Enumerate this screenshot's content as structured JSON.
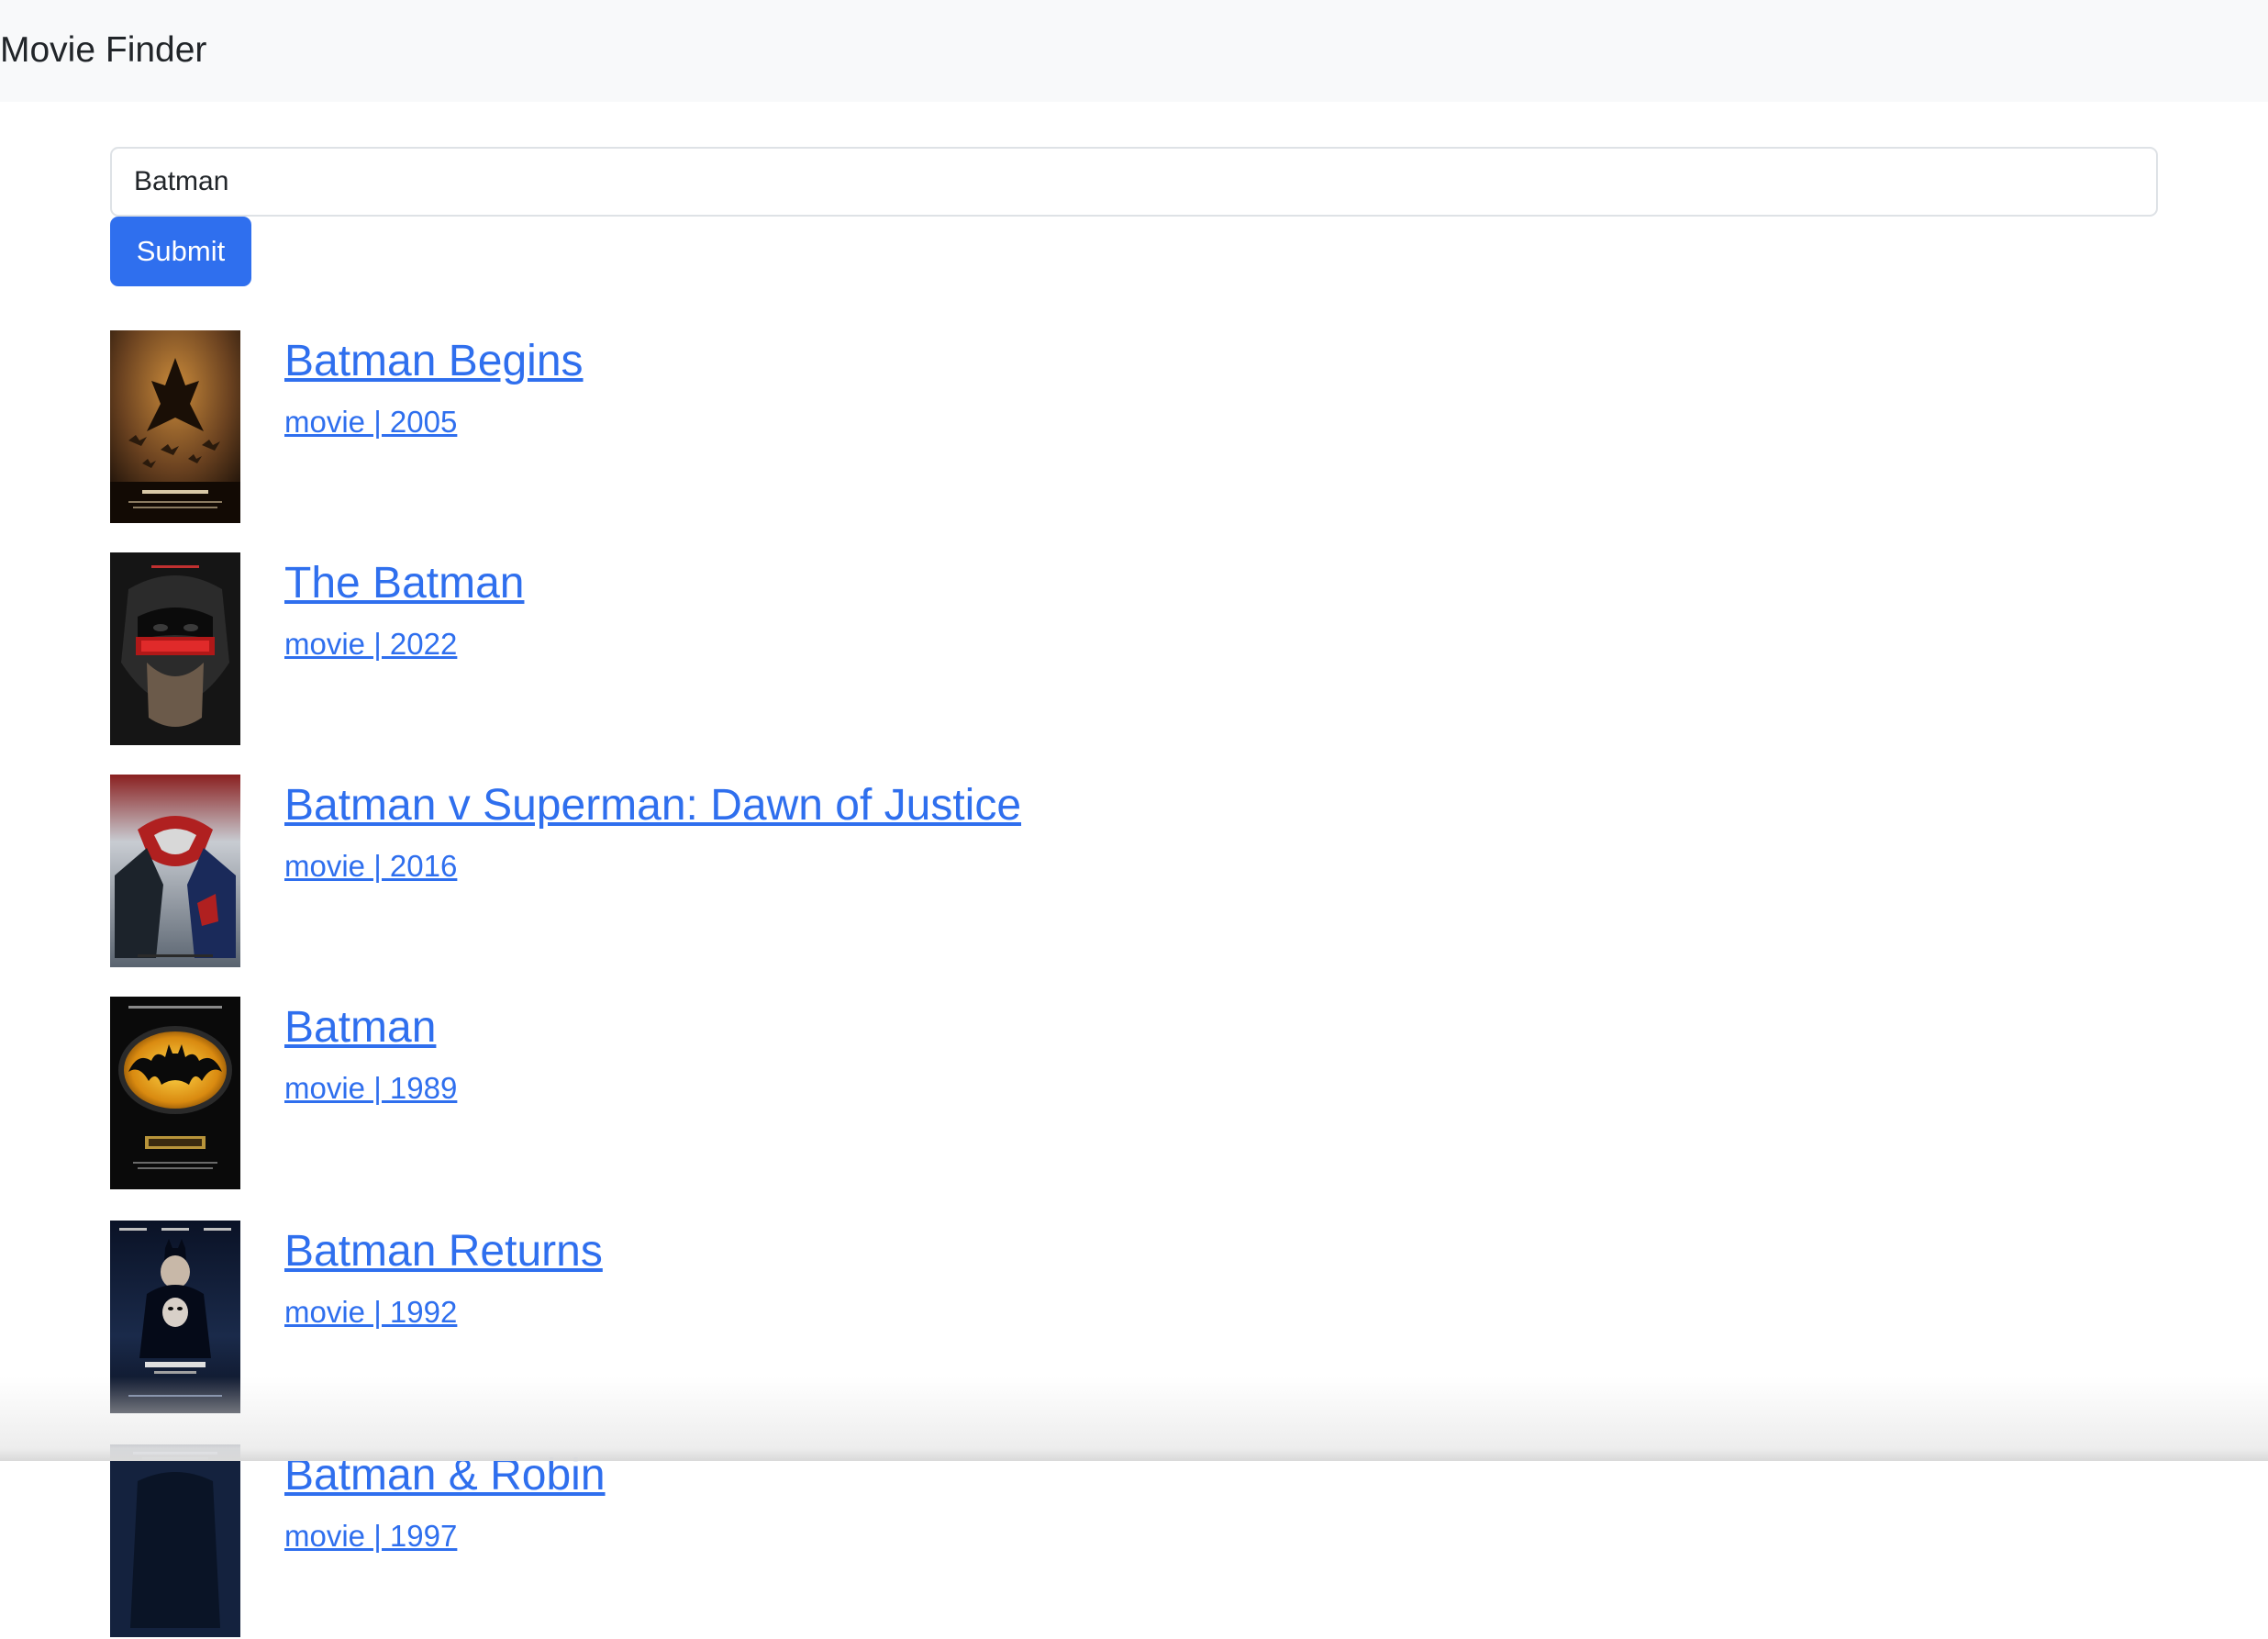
{
  "navbar": {
    "brand": "Movie Finder"
  },
  "search": {
    "value": "Batman",
    "submit_label": "Submit"
  },
  "results": [
    {
      "title": "Batman Begins",
      "meta": "movie | 2005",
      "poster_icon": "batman-begins-poster",
      "poster_color": "#5a3a1a"
    },
    {
      "title": "The Batman",
      "meta": "movie | 2022",
      "poster_icon": "the-batman-poster",
      "poster_color": "#1a1a1a"
    },
    {
      "title": "Batman v Superman: Dawn of Justice",
      "meta": "movie | 2016",
      "poster_icon": "batman-v-superman-poster",
      "poster_color": "#3a4a5a"
    },
    {
      "title": "Batman",
      "meta": "movie | 1989",
      "poster_icon": "batman-1989-poster",
      "poster_color": "#0d0d0d"
    },
    {
      "title": "Batman Returns",
      "meta": "movie | 1992",
      "poster_icon": "batman-returns-poster",
      "poster_color": "#0d1a33"
    },
    {
      "title": "Batman & Robin",
      "meta": "movie | 1997",
      "poster_icon": "batman-and-robin-poster",
      "poster_color": "#1a2a4a"
    }
  ],
  "colors": {
    "link": "#2f6fee",
    "button": "#2f6fee",
    "navbar_bg": "#f8f9fa"
  }
}
